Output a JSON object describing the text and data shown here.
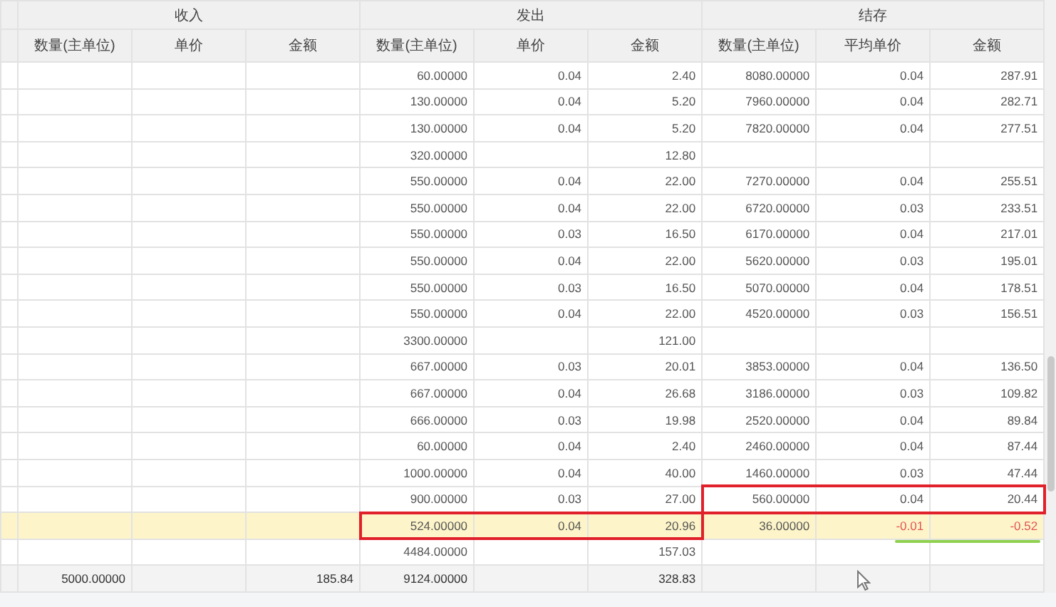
{
  "groups": [
    {
      "label": "收入",
      "columns": [
        "数量(主单位)",
        "单价",
        "金额"
      ]
    },
    {
      "label": "发出",
      "columns": [
        "数量(主单位)",
        "单价",
        "金额"
      ]
    },
    {
      "label": "结存",
      "columns": [
        "数量(主单位)",
        "平均单价",
        "金额"
      ]
    }
  ],
  "rows": [
    {
      "kind": "entry",
      "selected": false,
      "warning": false,
      "groups": [
        {
          "cells": [
            null,
            null,
            null
          ],
          "boxed": false
        },
        {
          "cells": [
            "60.00000",
            "0.04",
            "2.40"
          ],
          "boxed": false
        },
        {
          "cells": [
            "8080.00000",
            "0.04",
            "287.91"
          ],
          "boxed": false
        }
      ]
    },
    {
      "kind": "entry",
      "selected": false,
      "warning": false,
      "groups": [
        {
          "cells": [
            null,
            null,
            null
          ],
          "boxed": false
        },
        {
          "cells": [
            "130.00000",
            "0.04",
            "5.20"
          ],
          "boxed": false
        },
        {
          "cells": [
            "7960.00000",
            "0.04",
            "282.71"
          ],
          "boxed": false
        }
      ]
    },
    {
      "kind": "entry",
      "selected": false,
      "warning": false,
      "groups": [
        {
          "cells": [
            null,
            null,
            null
          ],
          "boxed": false
        },
        {
          "cells": [
            "130.00000",
            "0.04",
            "5.20"
          ],
          "boxed": false
        },
        {
          "cells": [
            "7820.00000",
            "0.04",
            "277.51"
          ],
          "boxed": false
        }
      ]
    },
    {
      "kind": "entry",
      "selected": false,
      "warning": false,
      "groups": [
        {
          "cells": [
            null,
            null,
            null
          ],
          "boxed": false
        },
        {
          "cells": [
            "320.00000",
            null,
            "12.80"
          ],
          "boxed": false
        },
        {
          "cells": [
            null,
            null,
            null
          ],
          "boxed": false
        }
      ]
    },
    {
      "kind": "entry",
      "selected": false,
      "warning": false,
      "groups": [
        {
          "cells": [
            null,
            null,
            null
          ],
          "boxed": false
        },
        {
          "cells": [
            "550.00000",
            "0.04",
            "22.00"
          ],
          "boxed": false
        },
        {
          "cells": [
            "7270.00000",
            "0.04",
            "255.51"
          ],
          "boxed": false
        }
      ]
    },
    {
      "kind": "entry",
      "selected": false,
      "warning": false,
      "groups": [
        {
          "cells": [
            null,
            null,
            null
          ],
          "boxed": false
        },
        {
          "cells": [
            "550.00000",
            "0.04",
            "22.00"
          ],
          "boxed": false
        },
        {
          "cells": [
            "6720.00000",
            "0.03",
            "233.51"
          ],
          "boxed": false
        }
      ]
    },
    {
      "kind": "entry",
      "selected": false,
      "warning": false,
      "groups": [
        {
          "cells": [
            null,
            null,
            null
          ],
          "boxed": false
        },
        {
          "cells": [
            "550.00000",
            "0.03",
            "16.50"
          ],
          "boxed": false
        },
        {
          "cells": [
            "6170.00000",
            "0.04",
            "217.01"
          ],
          "boxed": false
        }
      ]
    },
    {
      "kind": "entry",
      "selected": false,
      "warning": false,
      "groups": [
        {
          "cells": [
            null,
            null,
            null
          ],
          "boxed": false
        },
        {
          "cells": [
            "550.00000",
            "0.04",
            "22.00"
          ],
          "boxed": false
        },
        {
          "cells": [
            "5620.00000",
            "0.03",
            "195.01"
          ],
          "boxed": false
        }
      ]
    },
    {
      "kind": "entry",
      "selected": false,
      "warning": false,
      "groups": [
        {
          "cells": [
            null,
            null,
            null
          ],
          "boxed": false
        },
        {
          "cells": [
            "550.00000",
            "0.03",
            "16.50"
          ],
          "boxed": false
        },
        {
          "cells": [
            "5070.00000",
            "0.04",
            "178.51"
          ],
          "boxed": false
        }
      ]
    },
    {
      "kind": "entry",
      "selected": false,
      "warning": false,
      "groups": [
        {
          "cells": [
            null,
            null,
            null
          ],
          "boxed": false
        },
        {
          "cells": [
            "550.00000",
            "0.04",
            "22.00"
          ],
          "boxed": false
        },
        {
          "cells": [
            "4520.00000",
            "0.03",
            "156.51"
          ],
          "boxed": false
        }
      ]
    },
    {
      "kind": "entry",
      "selected": false,
      "warning": false,
      "groups": [
        {
          "cells": [
            null,
            null,
            null
          ],
          "boxed": false
        },
        {
          "cells": [
            "3300.00000",
            null,
            "121.00"
          ],
          "boxed": false
        },
        {
          "cells": [
            null,
            null,
            null
          ],
          "boxed": false
        }
      ]
    },
    {
      "kind": "entry",
      "selected": false,
      "warning": false,
      "groups": [
        {
          "cells": [
            null,
            null,
            null
          ],
          "boxed": false
        },
        {
          "cells": [
            "667.00000",
            "0.03",
            "20.01"
          ],
          "boxed": false
        },
        {
          "cells": [
            "3853.00000",
            "0.04",
            "136.50"
          ],
          "boxed": false
        }
      ]
    },
    {
      "kind": "entry",
      "selected": false,
      "warning": false,
      "groups": [
        {
          "cells": [
            null,
            null,
            null
          ],
          "boxed": false
        },
        {
          "cells": [
            "667.00000",
            "0.04",
            "26.68"
          ],
          "boxed": false
        },
        {
          "cells": [
            "3186.00000",
            "0.03",
            "109.82"
          ],
          "boxed": false
        }
      ]
    },
    {
      "kind": "entry",
      "selected": false,
      "warning": false,
      "groups": [
        {
          "cells": [
            null,
            null,
            null
          ],
          "boxed": false
        },
        {
          "cells": [
            "666.00000",
            "0.03",
            "19.98"
          ],
          "boxed": false
        },
        {
          "cells": [
            "2520.00000",
            "0.04",
            "89.84"
          ],
          "boxed": false
        }
      ]
    },
    {
      "kind": "entry",
      "selected": false,
      "warning": false,
      "groups": [
        {
          "cells": [
            null,
            null,
            null
          ],
          "boxed": false
        },
        {
          "cells": [
            "60.00000",
            "0.04",
            "2.40"
          ],
          "boxed": false
        },
        {
          "cells": [
            "2460.00000",
            "0.04",
            "87.44"
          ],
          "boxed": false
        }
      ]
    },
    {
      "kind": "entry",
      "selected": false,
      "warning": false,
      "groups": [
        {
          "cells": [
            null,
            null,
            null
          ],
          "boxed": false
        },
        {
          "cells": [
            "1000.00000",
            "0.04",
            "40.00"
          ],
          "boxed": false
        },
        {
          "cells": [
            "1460.00000",
            "0.03",
            "47.44"
          ],
          "boxed": false
        }
      ]
    },
    {
      "kind": "entry",
      "selected": false,
      "warning": false,
      "groups": [
        {
          "cells": [
            null,
            null,
            null
          ],
          "boxed": false
        },
        {
          "cells": [
            "900.00000",
            "0.03",
            "27.00"
          ],
          "boxed": false
        },
        {
          "cells": [
            "560.00000",
            "0.04",
            "20.44"
          ],
          "boxed": true
        }
      ]
    },
    {
      "kind": "entry",
      "selected": true,
      "warning": true,
      "groups": [
        {
          "cells": [
            null,
            null,
            null
          ],
          "boxed": false
        },
        {
          "cells": [
            "524.00000",
            "0.04",
            "20.96"
          ],
          "boxed": true
        },
        {
          "cells": [
            "36.00000",
            "-0.01",
            "-0.52"
          ],
          "boxed": false
        }
      ]
    },
    {
      "kind": "entry",
      "selected": false,
      "warning": false,
      "groups": [
        {
          "cells": [
            null,
            null,
            null
          ],
          "boxed": false
        },
        {
          "cells": [
            "4484.00000",
            null,
            "157.03"
          ],
          "boxed": false
        },
        {
          "cells": [
            null,
            null,
            null
          ],
          "boxed": false
        }
      ]
    },
    {
      "kind": "total",
      "selected": false,
      "warning": false,
      "groups": [
        {
          "cells": [
            "5000.00000",
            null,
            "185.84"
          ],
          "boxed": false
        },
        {
          "cells": [
            "9124.00000",
            null,
            "328.83"
          ],
          "boxed": false
        },
        {
          "cells": [
            null,
            null,
            null
          ],
          "boxed": false
        }
      ]
    }
  ]
}
